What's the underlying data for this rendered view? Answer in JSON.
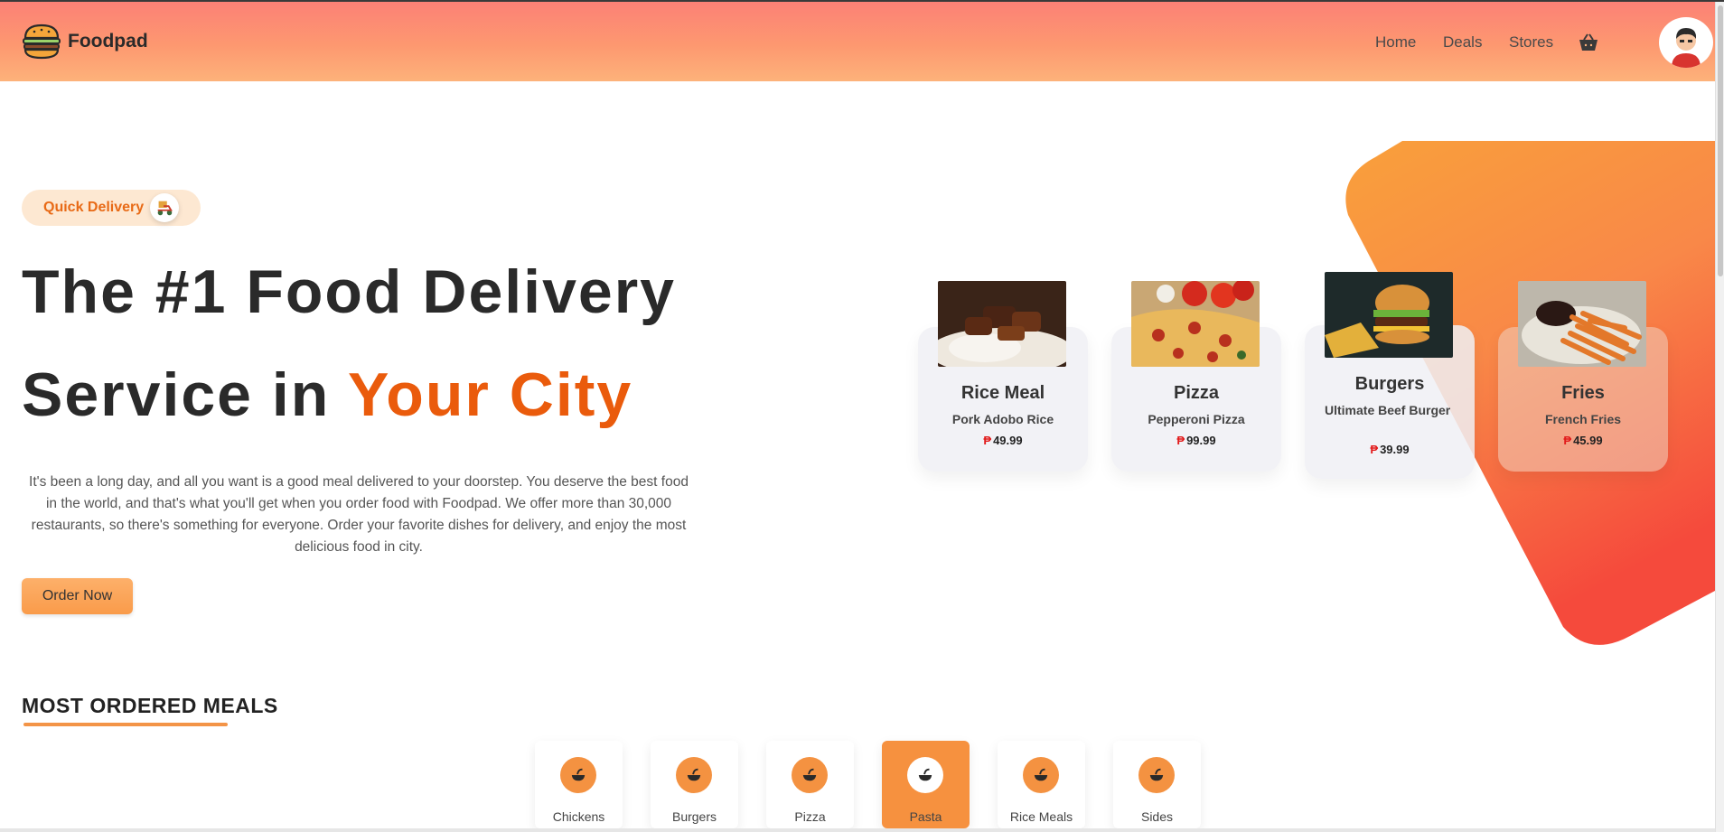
{
  "header": {
    "brand": "Foodpad",
    "nav": [
      "Home",
      "Deals",
      "Stores"
    ]
  },
  "hero": {
    "badge": "Quick Delivery",
    "title_line1": "The #1 Food Delivery",
    "title_line2_prefix": "Service in ",
    "title_line2_accent": "Your City",
    "description": "It's been a long day, and all you want is a good meal delivered to your doorstep. You deserve the best food in the world, and that's what you'll get when you order food with Foodpad. We offer more than 30,000 restaurants, so there's something for everyone. Order your favorite dishes for delivery, and enjoy the most delicious food in city.",
    "cta": "Order Now"
  },
  "food_cards": [
    {
      "title": "Rice Meal",
      "subtitle": "Pork Adobo Rice",
      "currency": "₱",
      "price": "49.99"
    },
    {
      "title": "Pizza",
      "subtitle": "Pepperoni Pizza",
      "currency": "₱",
      "price": "99.99"
    },
    {
      "title": "Burgers",
      "subtitle": "Ultimate Beef Burger",
      "currency": "₱",
      "price": "39.99"
    },
    {
      "title": "Fries",
      "subtitle": "French Fries",
      "currency": "₱",
      "price": "45.99"
    }
  ],
  "section": {
    "title": "MOST ORDERED MEALS"
  },
  "categories": [
    {
      "label": "Chickens",
      "active": false
    },
    {
      "label": "Burgers",
      "active": false
    },
    {
      "label": "Pizza",
      "active": false
    },
    {
      "label": "Pasta",
      "active": true
    },
    {
      "label": "Rice Meals",
      "active": false
    },
    {
      "label": "Sides",
      "active": false
    }
  ],
  "colors": {
    "accent": "#ea5b0c",
    "header_gradient_top": "#fc8176",
    "header_gradient_bottom": "#fdb27a",
    "category_orange": "#f6913f",
    "price_symbol": "#e21b1b"
  }
}
